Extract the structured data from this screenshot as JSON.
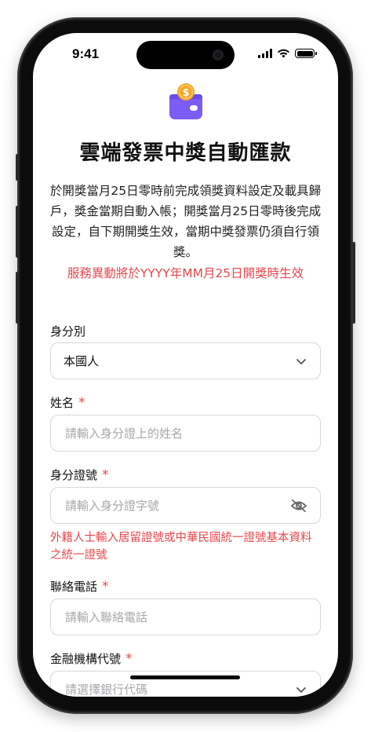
{
  "status_bar": {
    "time": "9:41",
    "battery_level": 1.0
  },
  "header": {
    "logo_icon": "wallet-coin-icon",
    "title": "雲端發票中獎自動匯款",
    "description": "於開獎當月25日零時前完成領獎資料設定及載具歸戶，獎金當期自動入帳；開獎當月25日零時後完成設定，自下期開獎生效，當期中獎發票仍須自行領獎。",
    "notice": "服務異動將於YYYY年MM月25日開獎時生效"
  },
  "form": {
    "identity": {
      "label": "身分別",
      "value": "本國人"
    },
    "name": {
      "label": "姓名",
      "required_mark": "*",
      "placeholder": "請輸入身分證上的姓名"
    },
    "id_number": {
      "label": "身分證號",
      "required_mark": "*",
      "placeholder": "請輸入身分證字號",
      "helper": "外籍人士輸入居留證號或中華民國統一證號基本資料之統一證號"
    },
    "phone": {
      "label": "聯絡電話",
      "required_mark": "*",
      "placeholder": "請輸入聯絡電話"
    },
    "bank_code": {
      "label": "金融機構代號",
      "required_mark": "*",
      "placeholder": "請選擇銀行代碼"
    }
  },
  "colors": {
    "accent": "#7b5cf5",
    "coin": "#f6a623",
    "error": "#e5484d"
  }
}
